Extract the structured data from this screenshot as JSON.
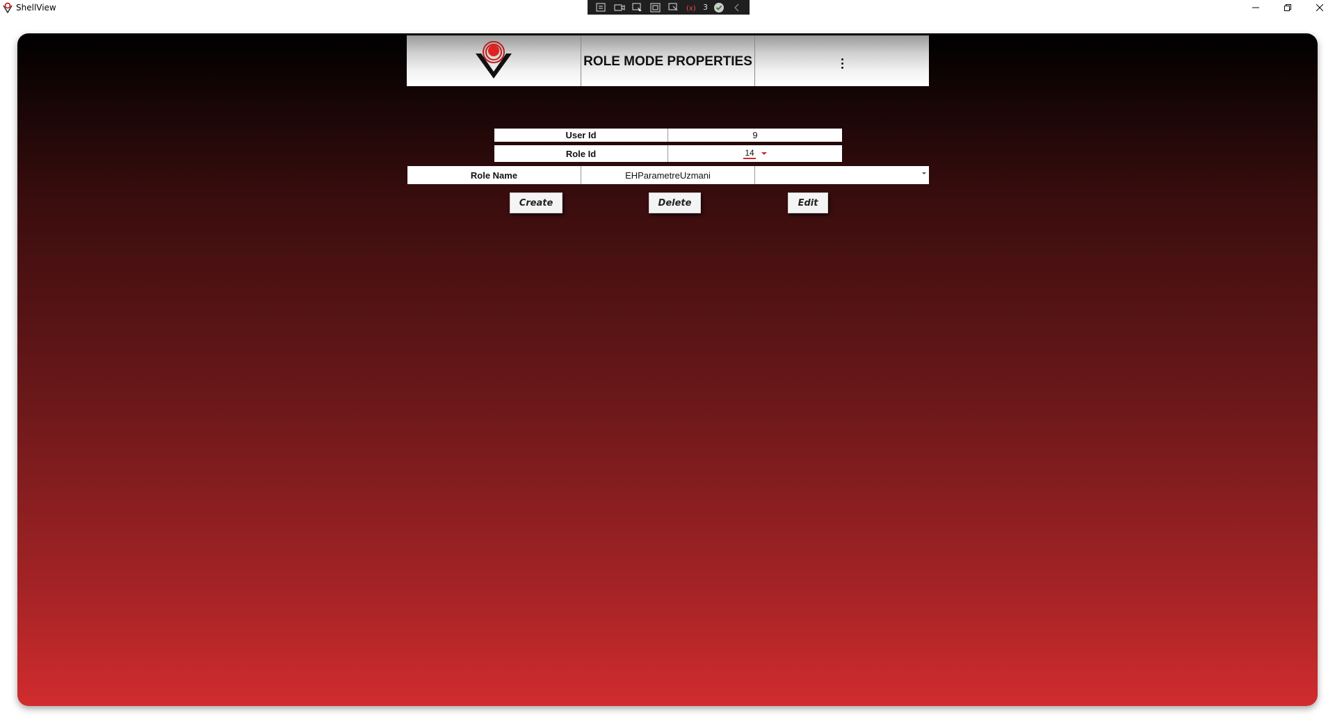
{
  "window": {
    "title": "ShellView",
    "minimize_icon": "minimize-icon",
    "restore_icon": "restore-icon",
    "close_icon": "close-icon"
  },
  "debug_toolbar": {
    "tools": [
      "live-visual-tree-icon",
      "record-icon",
      "select-element-icon",
      "display-layout-adorners-icon",
      "track-focus-icon",
      "binding-failures-icon",
      "hot-reload-icon",
      "collapse-icon"
    ],
    "binding_failures_count": "3"
  },
  "header": {
    "logo": "red-target-logo",
    "title": "ROLE MODE PROPERTIES",
    "menu_icon": "kebab-menu-icon"
  },
  "form": {
    "user_id": {
      "label": "User Id",
      "value": "9"
    },
    "role_id": {
      "label": "Role Id",
      "value": "14"
    },
    "role_name": {
      "label": "Role Name",
      "value": "EHParametreUzmani",
      "selected": ""
    }
  },
  "actions": {
    "create": "Create",
    "delete": "Delete",
    "edit": "Edit"
  },
  "colors": {
    "gradient_top": "#000000",
    "gradient_bottom": "#d12c2e",
    "accent": "#d12c2e"
  }
}
